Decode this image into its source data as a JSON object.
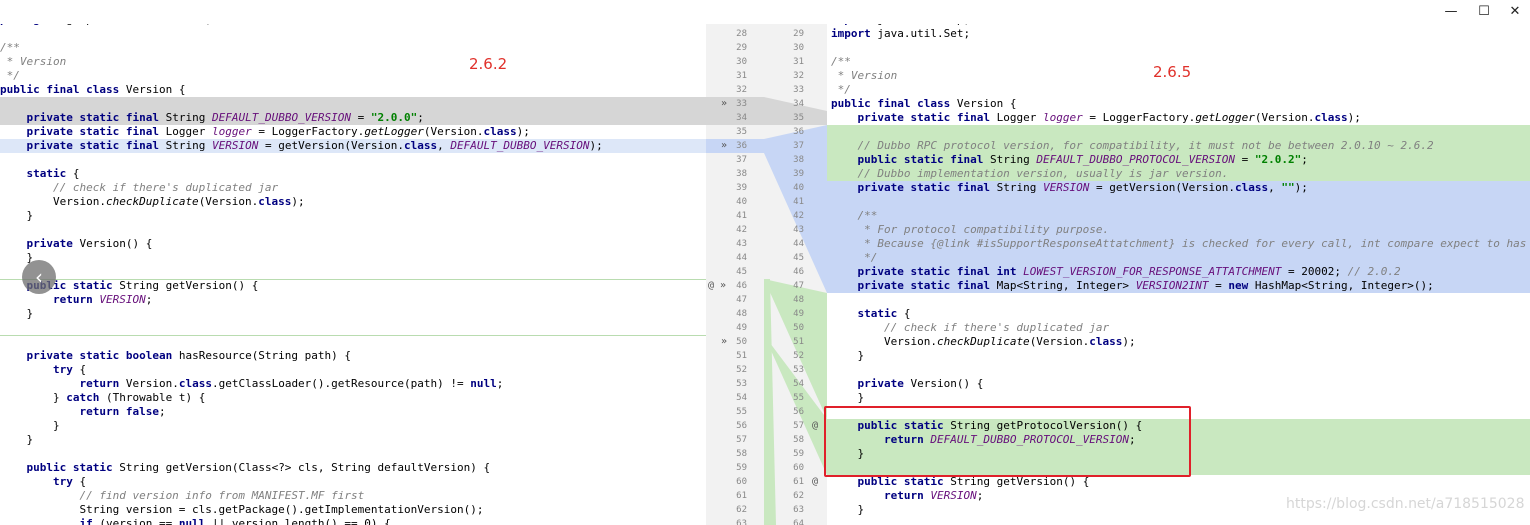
{
  "window": {
    "minimize": "—",
    "maximize": "☐",
    "close": "✕"
  },
  "labels": {
    "left_version": "2.6.2",
    "right_version": "2.6.5",
    "watermark": "https://blog.csdn.net/a718515028"
  },
  "left_lines": [
    "package org.apache.dubbo.common;",
    "",
    "/**",
    " * Version",
    " */",
    "public final class Version {",
    "",
    "    private static final String DEFAULT_DUBBO_VERSION = \"2.0.0\";",
    "    private static final Logger logger = LoggerFactory.getLogger(Version.class);",
    "    private static final String VERSION = getVersion(Version.class, DEFAULT_DUBBO_VERSION);",
    "",
    "    static {",
    "        // check if there's duplicated jar",
    "        Version.checkDuplicate(Version.class);",
    "    }",
    "",
    "    private Version() {",
    "    }",
    "",
    "    public static String getVersion() {",
    "        return VERSION;",
    "    }",
    "",
    "",
    "    private static boolean hasResource(String path) {",
    "        try {",
    "            return Version.class.getClassLoader().getResource(path) != null;",
    "        } catch (Throwable t) {",
    "            return false;",
    "        }",
    "    }",
    "",
    "    public static String getVersion(Class<?> cls, String defaultVersion) {",
    "        try {",
    "            // find version info from MANIFEST.MF first",
    "            String version = cls.getPackage().getImplementationVersion();",
    "            if (version == null || version.length() == 0) {"
  ],
  "right_lines": [
    "import java.util.Map;",
    "import java.util.Set;",
    "",
    "/**",
    " * Version",
    " */",
    "public final class Version {",
    "    private static final Logger logger = LoggerFactory.getLogger(Version.class);",
    "",
    "    // Dubbo RPC protocol version, for compatibility, it must not be between 2.0.10 ~ 2.6.2",
    "    public static final String DEFAULT_DUBBO_PROTOCOL_VERSION = \"2.0.2\";",
    "    // Dubbo implementation version, usually is jar version.",
    "    private static final String VERSION = getVersion(Version.class, \"\");",
    "",
    "    /**",
    "     * For protocol compatibility purpose.",
    "     * Because {@link #isSupportResponseAttatchment} is checked for every call, int compare expect to has",
    "     */",
    "    private static final int LOWEST_VERSION_FOR_RESPONSE_ATTATCHMENT = 20002; // 2.0.2",
    "    private static final Map<String, Integer> VERSION2INT = new HashMap<String, Integer>();",
    "",
    "    static {",
    "        // check if there's duplicated jar",
    "        Version.checkDuplicate(Version.class);",
    "    }",
    "",
    "    private Version() {",
    "    }",
    "",
    "    public static String getProtocolVersion() {",
    "        return DEFAULT_DUBBO_PROTOCOL_VERSION;",
    "    }",
    "",
    "    public static String getVersion() {",
    "        return VERSION;",
    "    }",
    ""
  ],
  "gutter_left_numbers": [
    "28",
    "29",
    "30",
    "31",
    "32",
    "33",
    "34",
    "35",
    "36",
    "37",
    "38",
    "39",
    "40",
    "41",
    "42",
    "43",
    "44",
    "45",
    "46",
    "47",
    "48",
    "49",
    "50",
    "51",
    "52",
    "53",
    "54",
    "55",
    "56",
    "57",
    "58",
    "59",
    "60",
    "61",
    "62",
    "63"
  ],
  "gutter_right_numbers": [
    "29",
    "30",
    "31",
    "32",
    "33",
    "34",
    "35",
    "36",
    "37",
    "38",
    "39",
    "40",
    "41",
    "42",
    "43",
    "44",
    "45",
    "46",
    "47",
    "48",
    "49",
    "50",
    "51",
    "52",
    "53",
    "54",
    "55",
    "56",
    "57",
    "58",
    "59",
    "60",
    "61",
    "62",
    "63",
    "64"
  ],
  "gutter_markers": [
    {
      "row": 5,
      "text": "»"
    },
    {
      "row": 8,
      "text": "»"
    },
    {
      "row": 18,
      "text": "@ »"
    },
    {
      "row": 22,
      "text": "»"
    }
  ],
  "right_markers": [
    {
      "row": 28,
      "text": "@"
    },
    {
      "row": 32,
      "text": "@"
    }
  ],
  "colors": {
    "added": "#c9e8c0",
    "modified": "#c7d6f5",
    "deleted": "#d6d6d6",
    "gutter": "#f2f2f2",
    "redbox": "#e0202a",
    "label": "#e0302a"
  }
}
